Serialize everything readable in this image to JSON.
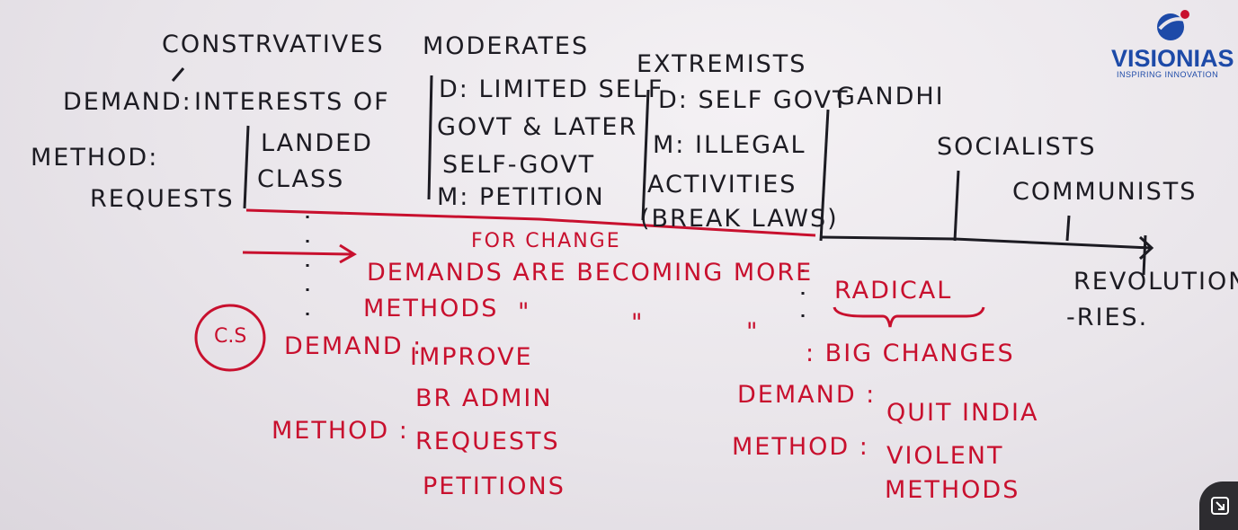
{
  "logo": {
    "name": "VISIONIAS",
    "tagline": "INSPIRING INNOVATION"
  },
  "headers": {
    "conservatives": "CONSTRVATIVES",
    "moderates": "MODERATES",
    "extremists": "EXTREMISTS",
    "gandhi": "GANDHI",
    "socialists": "SOCIALISTS",
    "communists": "COMMUNISTS",
    "revolutionaries_1": "REVOLUTIONA",
    "revolutionaries_2": "-RIES."
  },
  "conservatives": {
    "demand_label": "DEMAND:",
    "demand_1": "INTERESTS OF",
    "demand_2": "LANDED",
    "demand_3": "CLASS",
    "method_label": "METHOD:",
    "method": "REQUESTS"
  },
  "moderates": {
    "line_1": "D: LIMITED SELF",
    "line_2": "GOVT & LATER",
    "line_3": "SELF-GOVT",
    "line_4": "M: PETITION"
  },
  "extremists": {
    "line_1": "D: SELF GOVT",
    "line_2": "M: ILLEGAL",
    "line_3": "ACTIVITIES",
    "line_4": "(BREAK LAWS)"
  },
  "trend": {
    "for_change": "FOR CHANGE",
    "line_1": "DEMANDS ARE BECOMING MORE",
    "radical": "RADICAL",
    "methods": "METHODS",
    "ditto_1": "\"",
    "ditto_2": "\"",
    "ditto_3": "\"",
    "big_changes": ": BIG CHANGES"
  },
  "cs": {
    "circle": "C.S",
    "demand_label": "DEMAND :",
    "demand_1": "IMPROVE",
    "demand_2": "BR ADMIN",
    "method_label": "METHOD :",
    "method_1": "REQUESTS",
    "method_2": "PETITIONS"
  },
  "gandhi_block": {
    "demand_label": "DEMAND :",
    "demand": "QUIT INDIA",
    "method_label": "METHOD :",
    "method_1": "VIOLENT",
    "method_2": "METHODS"
  },
  "colors": {
    "marker_black": "#1c1b22",
    "marker_red": "#c8102e",
    "board": "#ebe7ec",
    "logo_blue": "#1d4aa8"
  },
  "icons": {
    "expand": "expand-icon",
    "logo": "globe-icon"
  }
}
